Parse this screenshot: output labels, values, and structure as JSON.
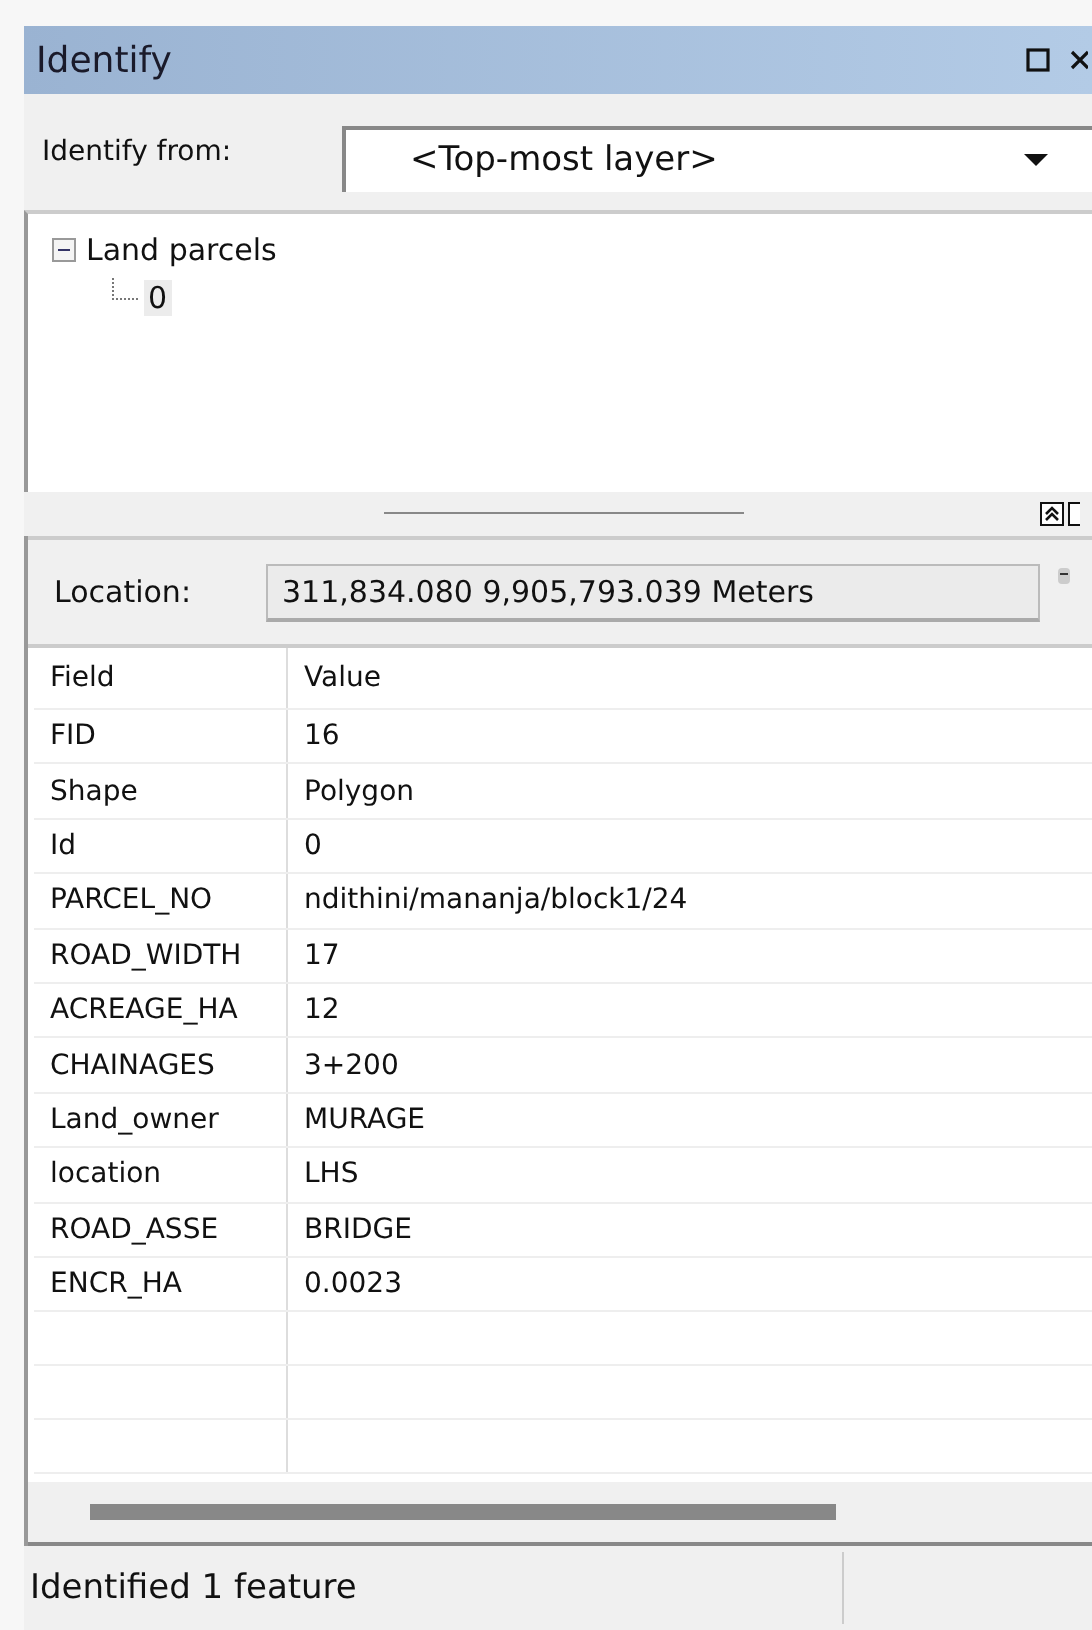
{
  "window": {
    "title": "Identify"
  },
  "identify_from": {
    "label": "Identify from:",
    "value": "<Top-most layer>"
  },
  "tree": [
    {
      "label": "Land parcels",
      "expanded": true,
      "children": [
        {
          "label": "0",
          "selected": true
        }
      ]
    }
  ],
  "location": {
    "label": "Location:",
    "value": "311,834.080  9,905,793.039 Meters"
  },
  "table": {
    "columns": [
      "Field",
      "Value"
    ],
    "rows": [
      [
        "FID",
        "16"
      ],
      [
        "Shape",
        "Polygon"
      ],
      [
        "Id",
        "0"
      ],
      [
        "PARCEL_NO",
        "ndithini/mananja/block1/24"
      ],
      [
        "ROAD_WIDTH",
        "17"
      ],
      [
        "ACREAGE_HA",
        "12"
      ],
      [
        "CHAINAGES",
        "3+200"
      ],
      [
        "Land_owner",
        "MURAGE"
      ],
      [
        "location",
        "LHS"
      ],
      [
        "ROAD_ASSE",
        "BRIDGE"
      ],
      [
        "ENCR_HA",
        "0.0023"
      ]
    ]
  },
  "status_bar": "Identified 1 feature"
}
